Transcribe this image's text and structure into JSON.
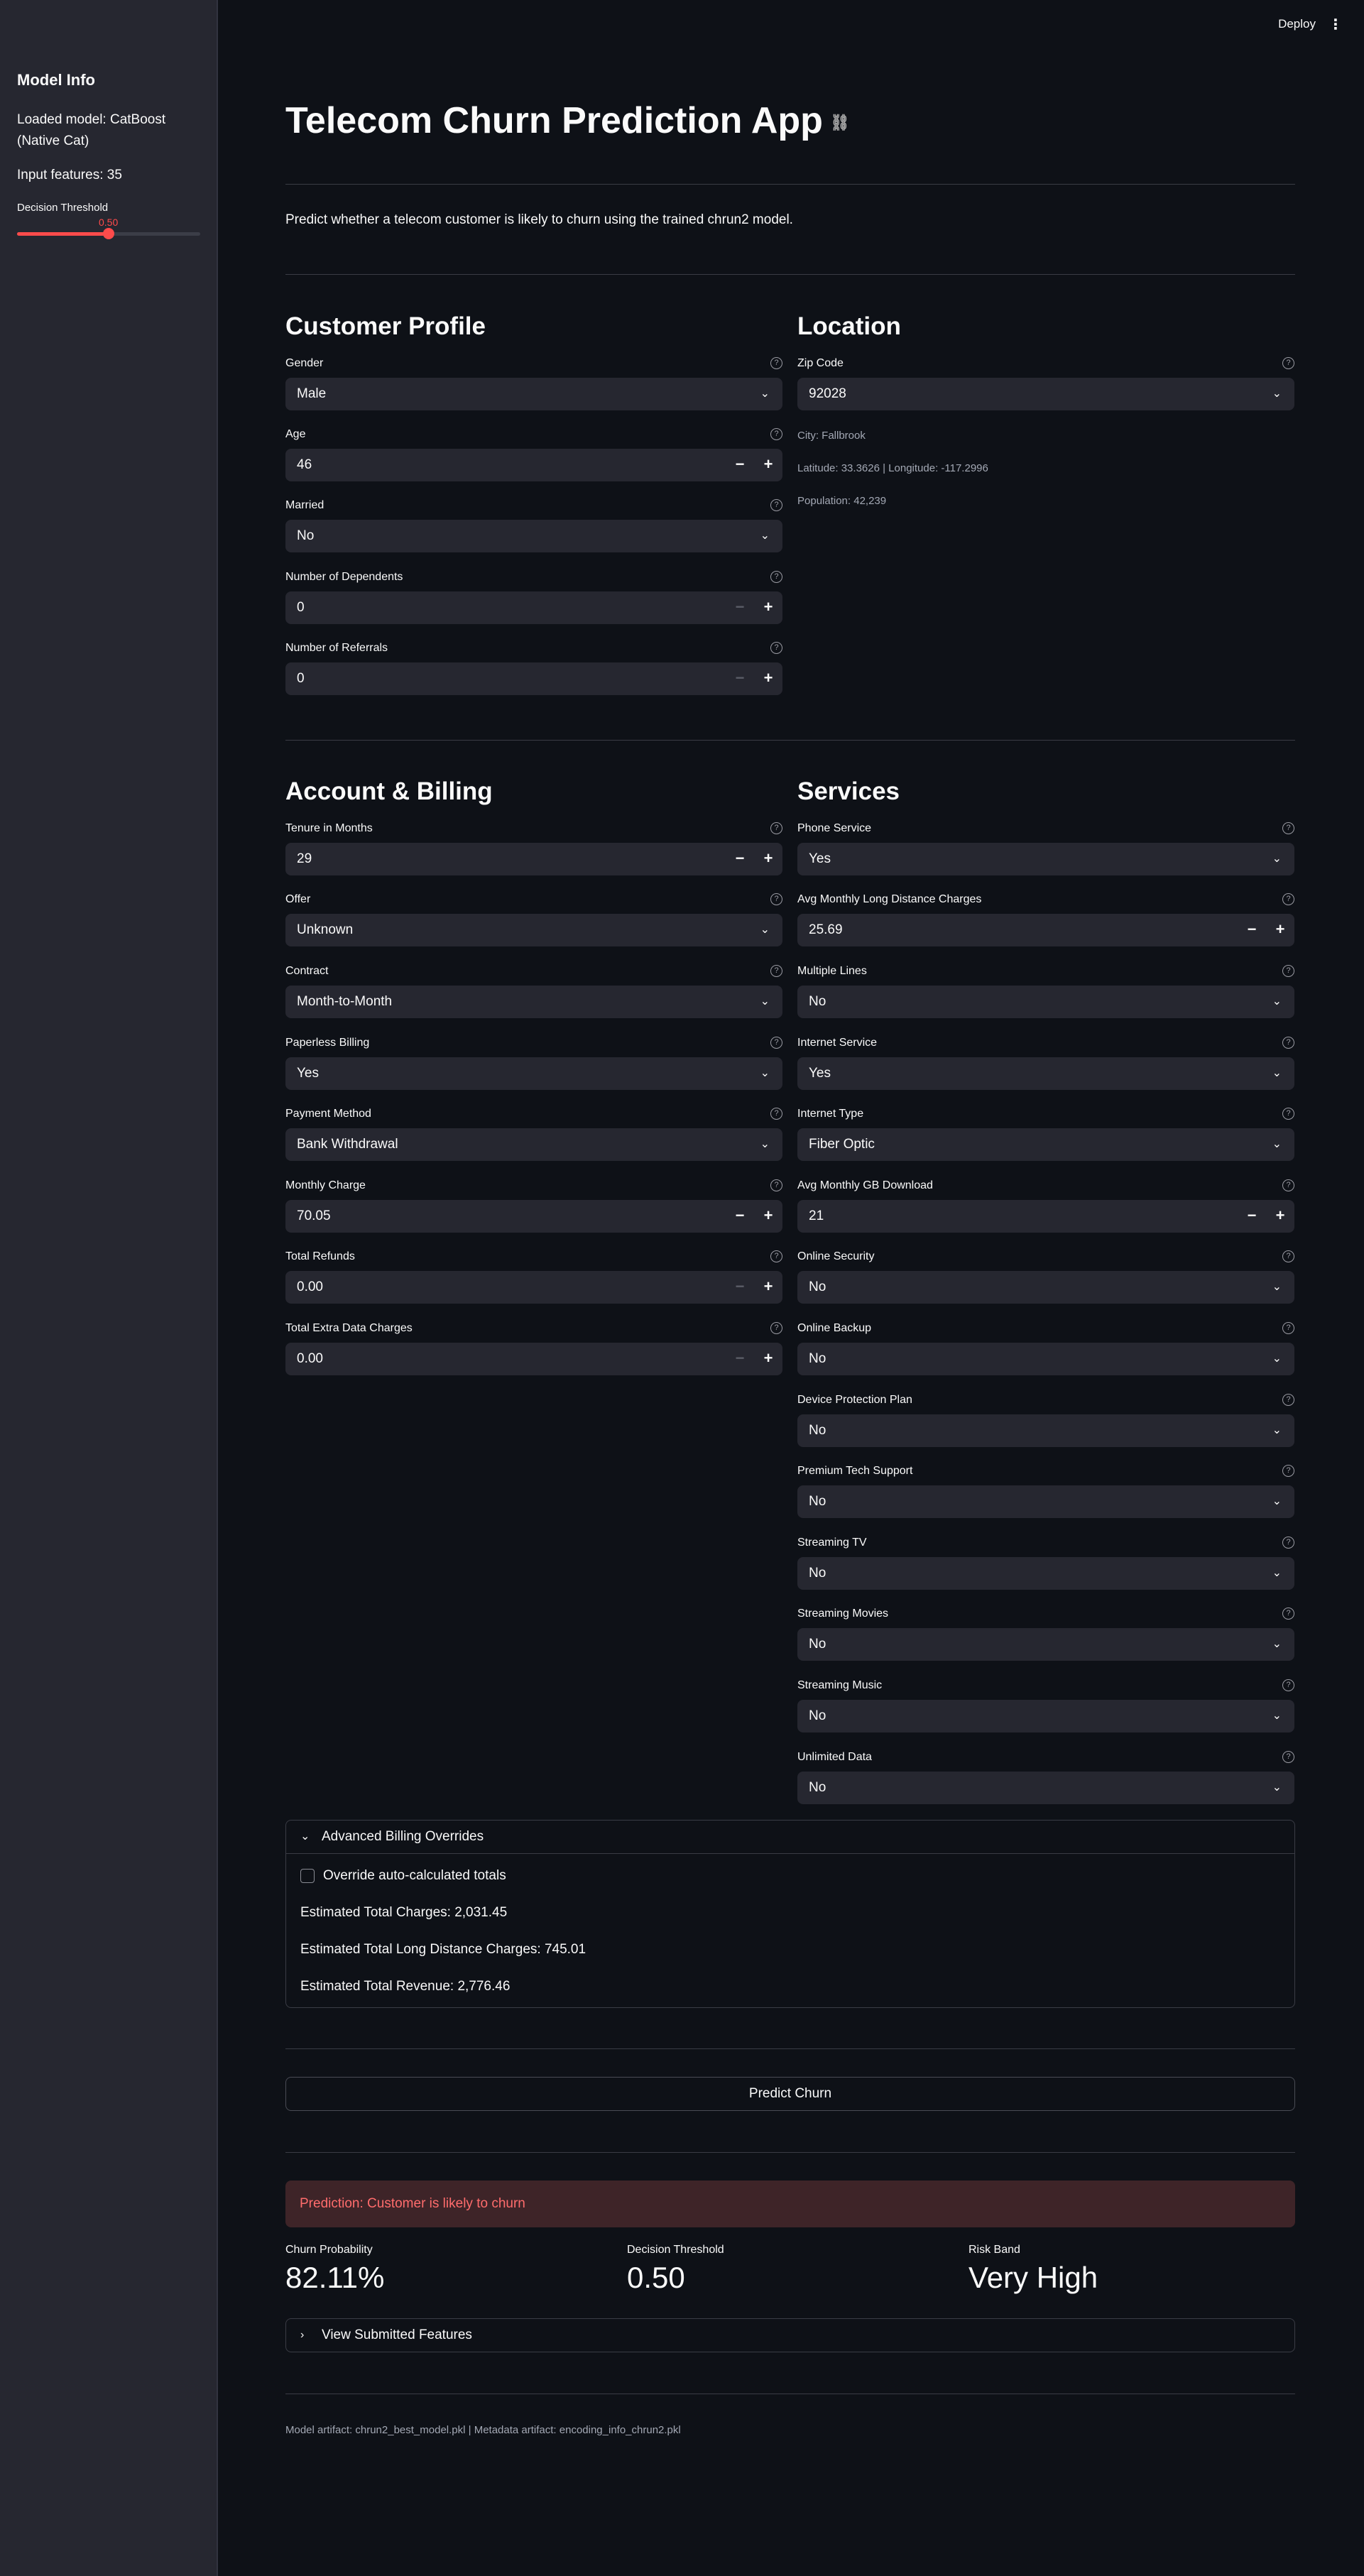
{
  "header": {
    "deploy_label": "Deploy",
    "menu_icon": "⋮"
  },
  "sidebar": {
    "title": "Model Info",
    "loaded_model": "Loaded model: CatBoost (Native Cat)",
    "input_features": "Input features: 35",
    "threshold_label": "Decision Threshold",
    "threshold_value": "0.50",
    "threshold_fraction": 0.5,
    "accent_color": "#ff4b4b"
  },
  "main": {
    "title": "Telecom Churn Prediction App",
    "intro": "Predict whether a telecom customer is likely to churn using the trained chrun2 model.",
    "customer_profile": {
      "title": "Customer Profile",
      "gender": {
        "label": "Gender",
        "value": "Male"
      },
      "age": {
        "label": "Age",
        "value": "46"
      },
      "married": {
        "label": "Married",
        "value": "No"
      },
      "dependents": {
        "label": "Number of Dependents",
        "value": "0"
      },
      "referrals": {
        "label": "Number of Referrals",
        "value": "0"
      }
    },
    "location": {
      "title": "Location",
      "zip": {
        "label": "Zip Code",
        "value": "92028"
      },
      "city": "City: Fallbrook",
      "latlon": "Latitude: 33.3626 | Longitude: -117.2996",
      "population": "Population: 42,239"
    },
    "account": {
      "title": "Account & Billing",
      "tenure": {
        "label": "Tenure in Months",
        "value": "29"
      },
      "offer": {
        "label": "Offer",
        "value": "Unknown"
      },
      "contract": {
        "label": "Contract",
        "value": "Month-to-Month"
      },
      "paperless": {
        "label": "Paperless Billing",
        "value": "Yes"
      },
      "payment": {
        "label": "Payment Method",
        "value": "Bank Withdrawal"
      },
      "monthly": {
        "label": "Monthly Charge",
        "value": "70.05"
      },
      "refunds": {
        "label": "Total Refunds",
        "value": "0.00"
      },
      "extra": {
        "label": "Total Extra Data Charges",
        "value": "0.00"
      }
    },
    "services": {
      "title": "Services",
      "phone": {
        "label": "Phone Service",
        "value": "Yes"
      },
      "long_distance": {
        "label": "Avg Monthly Long Distance Charges",
        "value": "25.69"
      },
      "multiple_lines": {
        "label": "Multiple Lines",
        "value": "No"
      },
      "internet": {
        "label": "Internet Service",
        "value": "Yes"
      },
      "internet_type": {
        "label": "Internet Type",
        "value": "Fiber Optic"
      },
      "gb_download": {
        "label": "Avg Monthly GB Download",
        "value": "21"
      },
      "online_security": {
        "label": "Online Security",
        "value": "No"
      },
      "online_backup": {
        "label": "Online Backup",
        "value": "No"
      },
      "device_protection": {
        "label": "Device Protection Plan",
        "value": "No"
      },
      "tech_support": {
        "label": "Premium Tech Support",
        "value": "No"
      },
      "streaming_tv": {
        "label": "Streaming TV",
        "value": "No"
      },
      "streaming_movies": {
        "label": "Streaming Movies",
        "value": "No"
      },
      "streaming_music": {
        "label": "Streaming Music",
        "value": "No"
      },
      "unlimited_data": {
        "label": "Unlimited Data",
        "value": "No"
      }
    },
    "advanced": {
      "header": "Advanced Billing Overrides",
      "override_label": "Override auto-calculated totals",
      "total_charges": "Estimated Total Charges: 2,031.45",
      "total_long_distance": "Estimated Total Long Distance Charges: 745.01",
      "total_revenue": "Estimated Total Revenue: 2,776.46"
    },
    "predict_label": "Predict Churn",
    "prediction_text": "Prediction: Customer is likely to churn",
    "metrics": {
      "probability": {
        "label": "Churn Probability",
        "value": "82.11%"
      },
      "threshold": {
        "label": "Decision Threshold",
        "value": "0.50"
      },
      "risk": {
        "label": "Risk Band",
        "value": "Very High"
      }
    },
    "submitted_label": "View Submitted Features",
    "footer": "Model artifact: chrun2_best_model.pkl | Metadata artifact: encoding_info_chrun2.pkl"
  }
}
